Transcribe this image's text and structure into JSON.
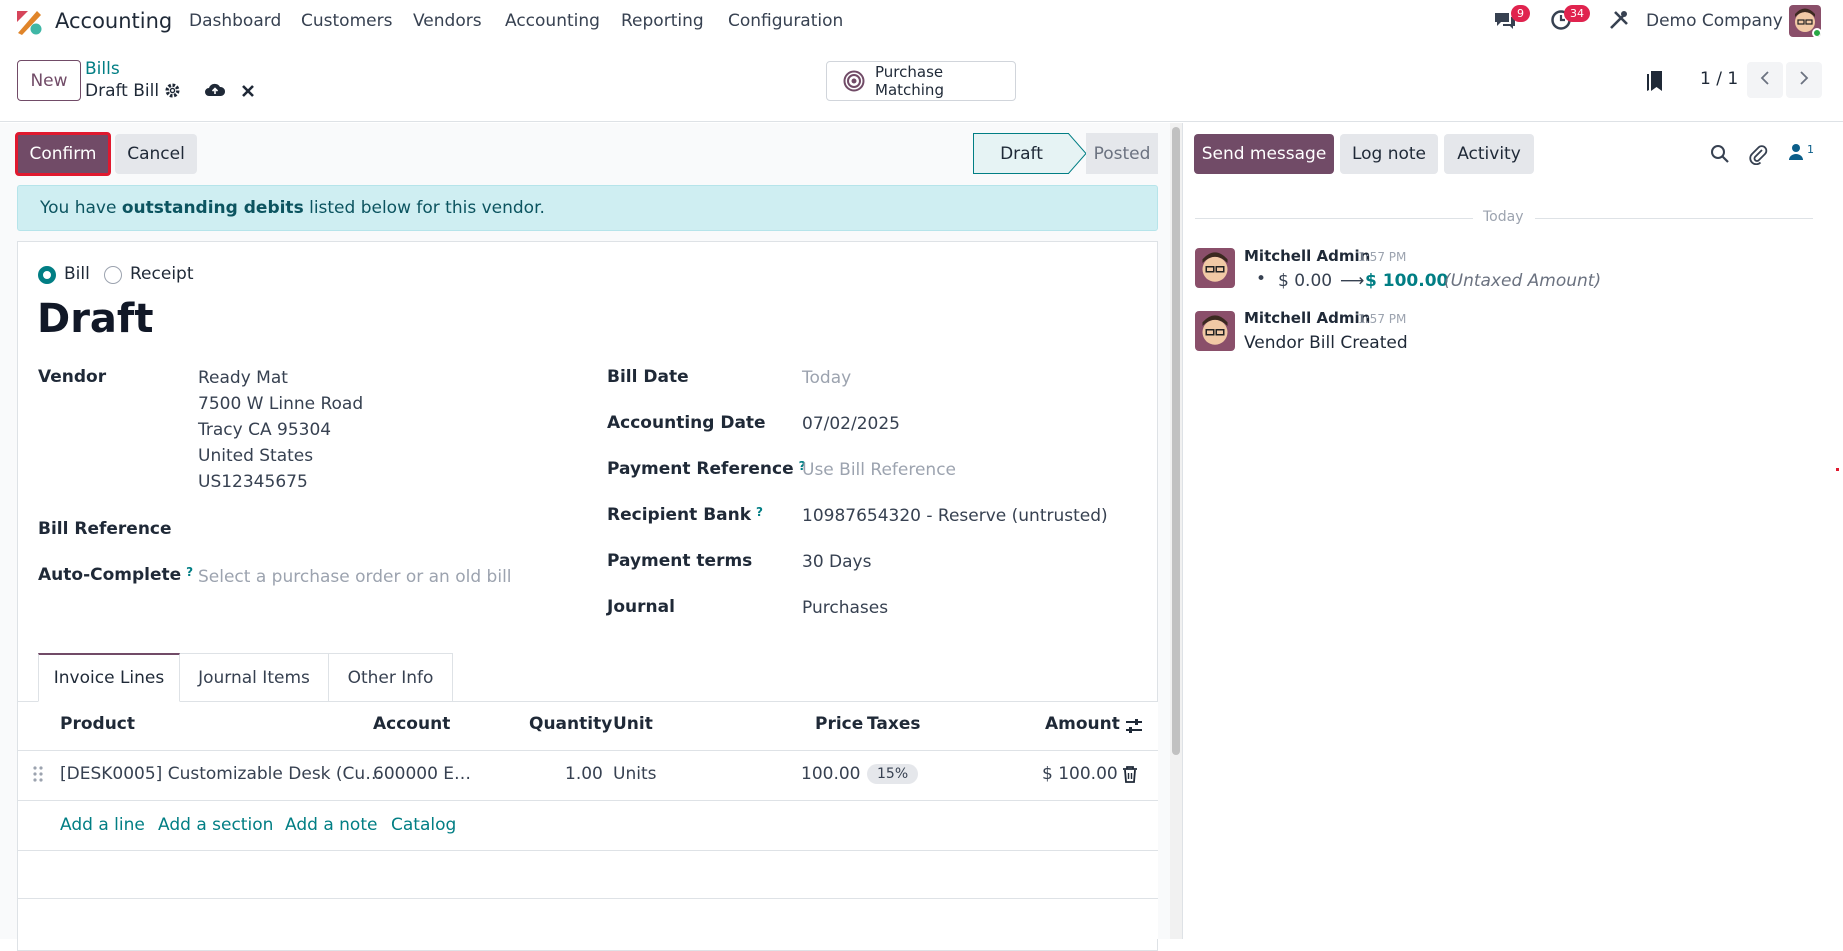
{
  "topnav": {
    "app_name": "Accounting",
    "menu": [
      "Dashboard",
      "Customers",
      "Vendors",
      "Accounting",
      "Reporting",
      "Configuration"
    ],
    "messages_count": "9",
    "activities_count": "34",
    "company": "Demo Company"
  },
  "control_panel": {
    "new_label": "New",
    "breadcrumb_parent": "Bills",
    "record_name": "Draft Bill",
    "purchase_matching_label": "Purchase Matching",
    "pager": "1 / 1"
  },
  "form": {
    "confirm_label": "Confirm",
    "cancel_label": "Cancel",
    "status_steps": [
      "Draft",
      "Posted"
    ],
    "active_status": "Draft",
    "alert": {
      "prefix": "You have ",
      "strong": "outstanding debits",
      "suffix": " listed below for this vendor."
    },
    "type_options": [
      "Bill",
      "Receipt"
    ],
    "type_selected": "Bill",
    "title": "Draft",
    "vendor": {
      "label": "Vendor",
      "name": "Ready Mat",
      "address": [
        "7500 W Linne Road",
        "Tracy CA 95304",
        "United States",
        "US12345675"
      ]
    },
    "bill_reference_label": "Bill Reference",
    "auto_complete": {
      "label": "Auto-Complete",
      "help": "?",
      "placeholder": "Select a purchase order or an old bill"
    },
    "bill_date": {
      "label": "Bill Date",
      "placeholder": "Today"
    },
    "accounting_date": {
      "label": "Accounting Date",
      "value": "07/02/2025"
    },
    "payment_reference": {
      "label": "Payment Reference",
      "help": "?",
      "placeholder": "Use Bill Reference"
    },
    "recipient_bank": {
      "label": "Recipient Bank",
      "help": "?",
      "value": "10987654320 - Reserve (untrusted)"
    },
    "payment_terms": {
      "label": "Payment terms",
      "value": "30 Days"
    },
    "journal": {
      "label": "Journal",
      "value": "Purchases"
    },
    "tabs": [
      "Invoice Lines",
      "Journal Items",
      "Other Info"
    ],
    "active_tab": "Invoice Lines",
    "columns": {
      "product": "Product",
      "account": "Account",
      "quantity": "Quantity",
      "unit": "Unit",
      "price": "Price",
      "taxes": "Taxes",
      "amount": "Amount"
    },
    "lines": [
      {
        "product": "[DESK0005] Customizable Desk (Cu…",
        "account": "600000 E…",
        "quantity": "1.00",
        "unit": "Units",
        "price": "100.00",
        "taxes": "15%",
        "amount": "$ 100.00"
      }
    ],
    "add_links": [
      "Add a line",
      "Add a section",
      "Add a note",
      "Catalog"
    ]
  },
  "chatter": {
    "send_message_label": "Send message",
    "log_note_label": "Log note",
    "activity_label": "Activity",
    "followers_count": "1",
    "date_separator": "Today",
    "messages": [
      {
        "author": "Mitchell Admin",
        "time": "1:57 PM",
        "change_from": "$ 0.00",
        "arrow": "⟶",
        "change_to": "$ 100.00",
        "field": "(Untaxed Amount)"
      },
      {
        "author": "Mitchell Admin",
        "time": "1:57 PM",
        "body": "Vendor Bill Created"
      }
    ]
  },
  "colors": {
    "brand": "#714b67",
    "teal": "#017e84",
    "alert_bg": "#cfeef2",
    "badge": "#e0234e"
  }
}
